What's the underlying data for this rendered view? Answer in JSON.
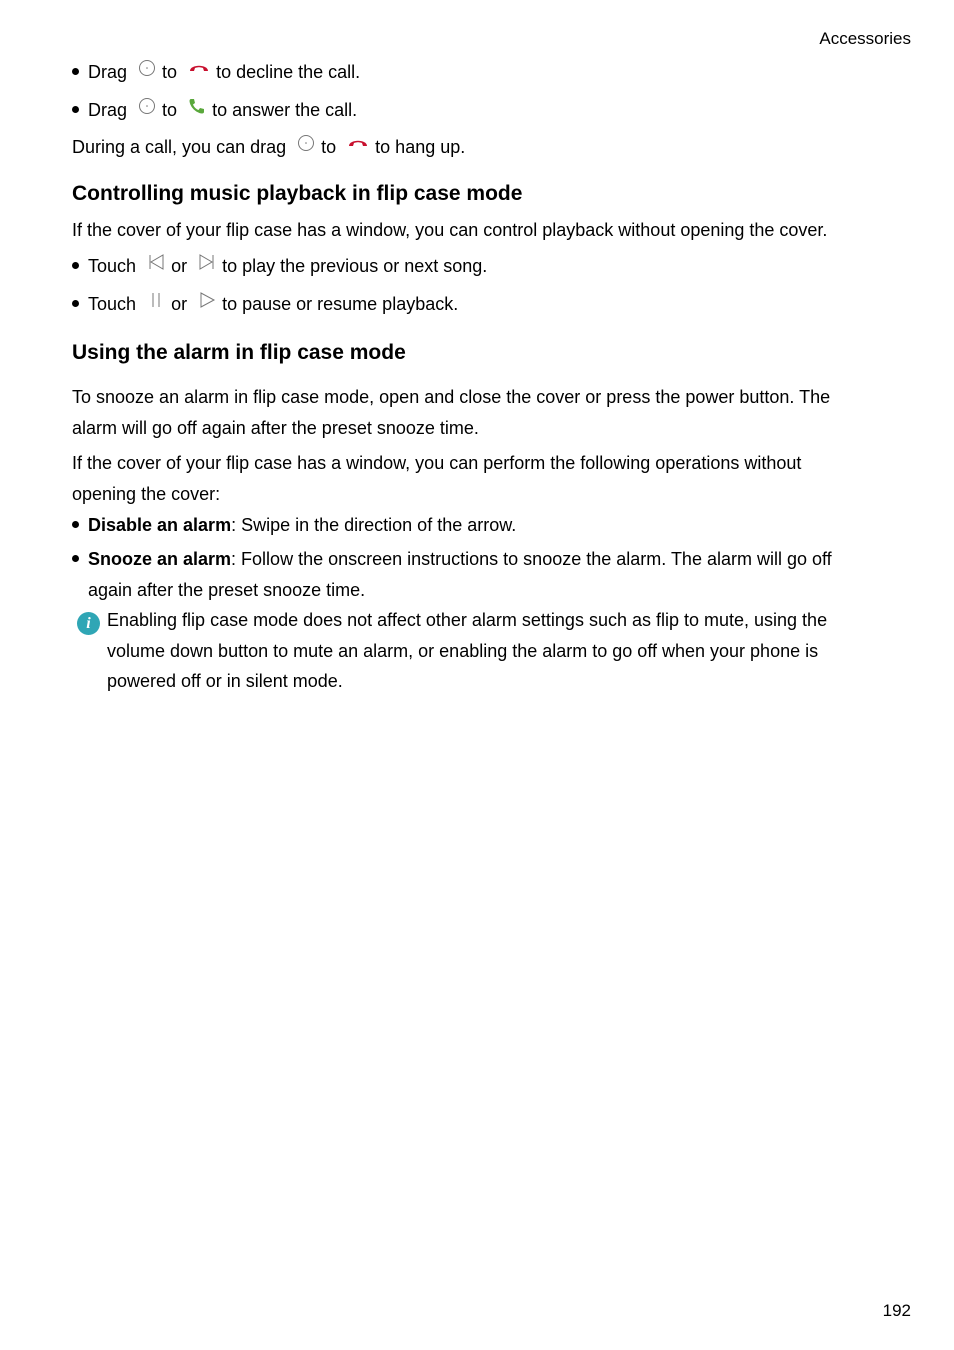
{
  "header": {
    "section": "Accessories"
  },
  "page_number": "192",
  "call_section": {
    "decline": {
      "prefix": "Drag",
      "mid": "to",
      "suffix": "to decline the call.",
      "icons": [
        "drag-handle-icon",
        "decline-call-icon"
      ]
    },
    "answer": {
      "prefix": "Drag",
      "mid": "to",
      "suffix": "to answer the call.",
      "icons": [
        "drag-handle-icon",
        "answer-call-icon"
      ]
    },
    "hangup": {
      "prefix": "During a call, you can drag",
      "mid": "to",
      "suffix": "to hang up.",
      "icons": [
        "drag-handle-icon",
        "hang-up-icon"
      ]
    }
  },
  "music_section": {
    "heading": "Controlling music playback in flip case mode",
    "intro": "If the cover of your flip case has a window, you can control playback without opening the cover.",
    "item1": {
      "prefix": "Touch",
      "mid": "or",
      "suffix": "to play the previous or next song.",
      "icons": [
        "previous-track-icon",
        "next-track-icon"
      ]
    },
    "item2": {
      "prefix": "Touch",
      "mid": "or",
      "suffix": "to pause or resume playback.",
      "icons": [
        "pause-icon",
        "play-icon"
      ]
    }
  },
  "alarm_section": {
    "heading": "Using the alarm in flip case mode",
    "para1_line1": "To snooze an alarm in flip case mode, open and close the cover or press the power button. The",
    "para1_line2": "alarm will go off again after the preset snooze time.",
    "para2_line1": "If the cover of your flip case has a window, you can perform the following operations without",
    "para2_line2": "opening the cover:",
    "item1": {
      "bold": "Disable an alarm",
      "text": ": Swipe in the direction of the arrow."
    },
    "item2": {
      "bold": "Snooze an alarm",
      "text": ": Follow the onscreen instructions to snooze the alarm. The alarm will go off",
      "cont": "again after the preset snooze time."
    },
    "note": {
      "icon": "info-icon",
      "line1": "Enabling flip case mode does not affect other alarm settings such as flip to mute, using the",
      "line2": "volume down button to mute an alarm, or enabling the alarm to go off when your phone is",
      "line3": "powered off or in silent mode."
    }
  },
  "colors": {
    "decline_red": "#c8102e",
    "answer_green": "#5aa83c",
    "info_teal": "#2fa6b5"
  }
}
